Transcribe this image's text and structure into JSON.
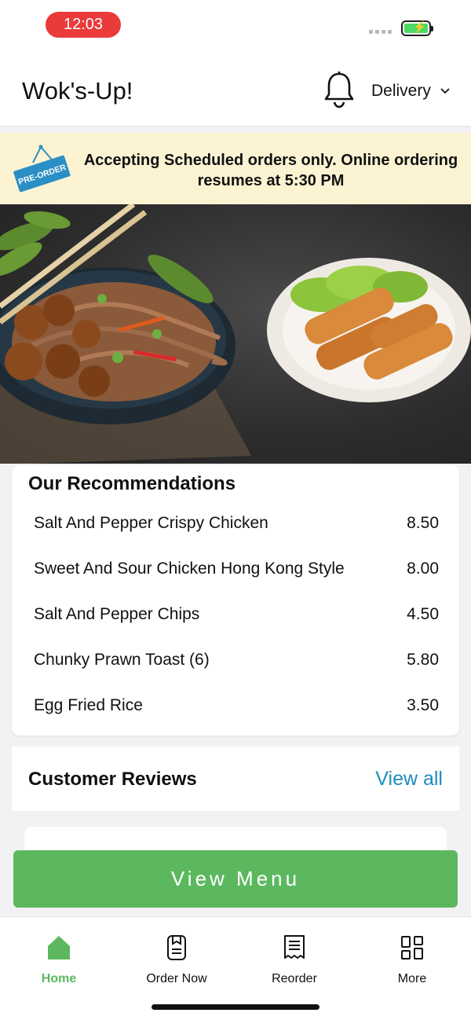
{
  "status_bar": {
    "time": "12:03"
  },
  "header": {
    "title": "Wok's-Up!",
    "delivery_label": "Delivery"
  },
  "banner": {
    "badge": "PRE-ORDER",
    "message": "Accepting Scheduled orders only. Online ordering resumes at 5:30 PM"
  },
  "recommendations": {
    "title": "Our Recommendations",
    "items": [
      {
        "name": "Salt And Pepper Crispy Chicken",
        "price": "8.50"
      },
      {
        "name": "Sweet And Sour Chicken Hong Kong Style",
        "price": "8.00"
      },
      {
        "name": "Salt And Pepper Chips",
        "price": "4.50"
      },
      {
        "name": "Chunky Prawn Toast (6)",
        "price": "5.80"
      },
      {
        "name": "Egg Fried Rice",
        "price": "3.50"
      }
    ]
  },
  "reviews": {
    "title": "Customer Reviews",
    "view_all": "View all"
  },
  "view_menu_label": "View Menu",
  "tabs": [
    {
      "label": "Home",
      "icon": "home-icon",
      "active": true
    },
    {
      "label": "Order Now",
      "icon": "order-icon",
      "active": false
    },
    {
      "label": "Reorder",
      "icon": "receipt-icon",
      "active": false
    },
    {
      "label": "More",
      "icon": "grid-icon",
      "active": false
    }
  ],
  "colors": {
    "accent_green": "#5cb85f",
    "link_blue": "#1f8bbf",
    "banner_bg": "#fcf3d3",
    "time_pill": "#ea3a3a"
  }
}
